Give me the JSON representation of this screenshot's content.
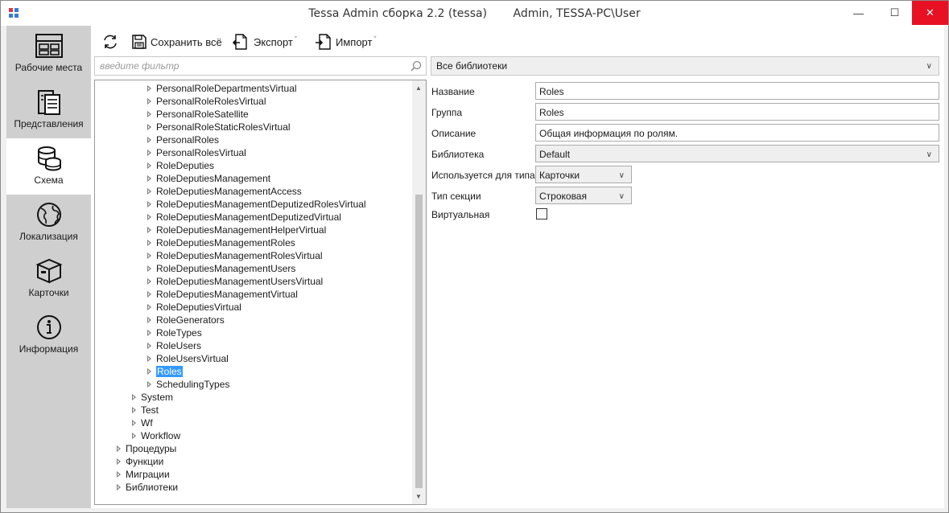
{
  "window": {
    "title": "Tessa Admin сборка 2.2 (tessa)",
    "user": "Admin, TESSA-PC\\User",
    "minimize_glyph": "—",
    "maximize_glyph": "☐",
    "close_glyph": "✕"
  },
  "nav": {
    "items": [
      {
        "label": "Рабочие места",
        "icon": "workplaces-icon"
      },
      {
        "label": "Представления",
        "icon": "views-icon"
      },
      {
        "label": "Схема",
        "icon": "database-icon",
        "active": true
      },
      {
        "label": "Локализация",
        "icon": "globe-icon"
      },
      {
        "label": "Карточки",
        "icon": "box-icon"
      },
      {
        "label": "Информация",
        "icon": "info-icon"
      }
    ]
  },
  "toolbar": {
    "save_label": "Сохранить всё",
    "export_label": "Экспорт",
    "import_label": "Импорт",
    "caret": "ˇ"
  },
  "filter": {
    "placeholder": "введите фильтр"
  },
  "library_select": {
    "value": "Все библиотеки"
  },
  "tree": {
    "rows": [
      {
        "label": "PersonalRoleDepartmentsVirtual",
        "level": 3
      },
      {
        "label": "PersonalRoleRolesVirtual",
        "level": 3
      },
      {
        "label": "PersonalRoleSatellite",
        "level": 3
      },
      {
        "label": "PersonalRoleStaticRolesVirtual",
        "level": 3
      },
      {
        "label": "PersonalRoles",
        "level": 3
      },
      {
        "label": "PersonalRolesVirtual",
        "level": 3
      },
      {
        "label": "RoleDeputies",
        "level": 3
      },
      {
        "label": "RoleDeputiesManagement",
        "level": 3
      },
      {
        "label": "RoleDeputiesManagementAccess",
        "level": 3
      },
      {
        "label": "RoleDeputiesManagementDeputizedRolesVirtual",
        "level": 3
      },
      {
        "label": "RoleDeputiesManagementDeputizedVirtual",
        "level": 3
      },
      {
        "label": "RoleDeputiesManagementHelperVirtual",
        "level": 3
      },
      {
        "label": "RoleDeputiesManagementRoles",
        "level": 3
      },
      {
        "label": "RoleDeputiesManagementRolesVirtual",
        "level": 3
      },
      {
        "label": "RoleDeputiesManagementUsers",
        "level": 3
      },
      {
        "label": "RoleDeputiesManagementUsersVirtual",
        "level": 3
      },
      {
        "label": "RoleDeputiesManagementVirtual",
        "level": 3
      },
      {
        "label": "RoleDeputiesVirtual",
        "level": 3
      },
      {
        "label": "RoleGenerators",
        "level": 3
      },
      {
        "label": "RoleTypes",
        "level": 3
      },
      {
        "label": "RoleUsers",
        "level": 3
      },
      {
        "label": "RoleUsersVirtual",
        "level": 3
      },
      {
        "label": "Roles",
        "level": 3,
        "selected": true
      },
      {
        "label": "SchedulingTypes",
        "level": 3
      },
      {
        "label": "System",
        "level": 2
      },
      {
        "label": "Test",
        "level": 2
      },
      {
        "label": "Wf",
        "level": 2
      },
      {
        "label": "Workflow",
        "level": 2
      },
      {
        "label": "Процедуры",
        "level": 1
      },
      {
        "label": "Функции",
        "level": 1
      },
      {
        "label": "Миграции",
        "level": 1
      },
      {
        "label": "Библиотеки",
        "level": 1
      }
    ],
    "scroll_position": 0.27
  },
  "properties": {
    "name_label": "Название",
    "name_value": "Roles",
    "group_label": "Группа",
    "group_value": "Roles",
    "description_label": "Описание",
    "description_value": "Общая информация по ролям.",
    "library_label": "Библиотека",
    "library_value": "Default",
    "used_for_label": "Используется для типа",
    "used_for_value": "Карточки",
    "section_type_label": "Тип секции",
    "section_type_value": "Строковая",
    "virtual_label": "Виртуальная",
    "virtual_checked": false
  },
  "colors": {
    "selection": "#3399ff",
    "close_button": "#e81123",
    "nav_background": "#cfcfcf"
  }
}
